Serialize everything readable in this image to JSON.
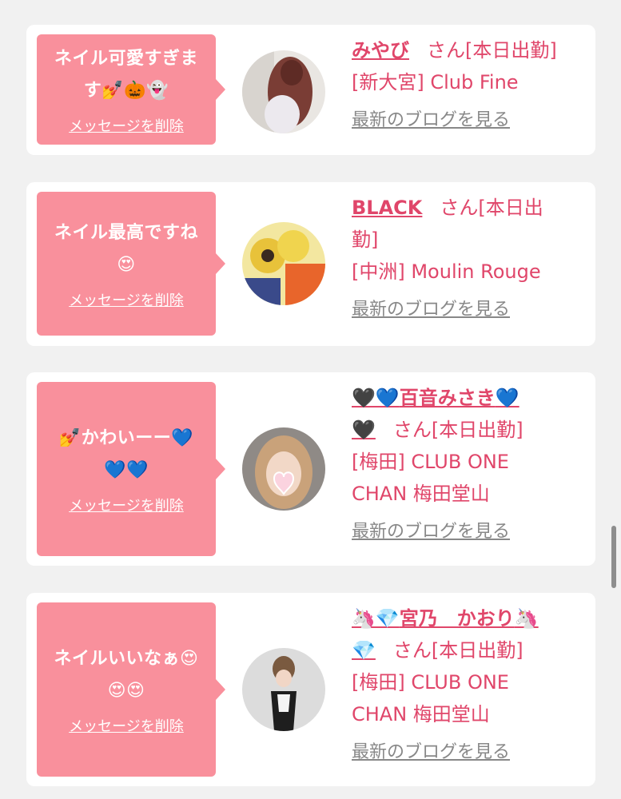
{
  "messages": [
    {
      "message_line1": "ネイル可愛すぎま",
      "message_line2": "す💅🎃👻",
      "delete_label": "メッセージを削除",
      "name": "みやび",
      "san": "さん[本日出勤]",
      "area": "[新大宮] Club Fine",
      "blog_link": "最新のブログを見る"
    },
    {
      "message_line1": "ネイル最高ですね",
      "message_line2": "😍",
      "delete_label": "メッセージを削除",
      "name": "BLACK",
      "san_line1": "さん[本日出",
      "san_line2": "勤]",
      "area": "[中洲] Moulin Rouge",
      "blog_link": "最新のブログを見る"
    },
    {
      "message_line1": "💅かわいーー💙",
      "message_line2": "💙💙",
      "delete_label": "メッセージを削除",
      "name_prefix": "🖤💙",
      "name": "百音みさき",
      "name_suffix": "💙",
      "name_line2": "🖤",
      "san": "さん[本日出勤]",
      "area_line1": "[梅田] CLUB ONE",
      "area_line2": "CHAN 梅田堂山",
      "blog_link": "最新のブログを見る"
    },
    {
      "message_line1": "ネイルいいなぁ😍",
      "message_line2": "😍😍",
      "delete_label": "メッセージを削除",
      "name_prefix": "🦄💎",
      "name": "宮乃　かおり",
      "name_suffix": "🦄",
      "name_line2": "💎",
      "san": "さん[本日出勤]",
      "area_line1": "[梅田] CLUB ONE",
      "area_line2": "CHAN 梅田堂山",
      "blog_link": "最新のブログを見る"
    }
  ]
}
